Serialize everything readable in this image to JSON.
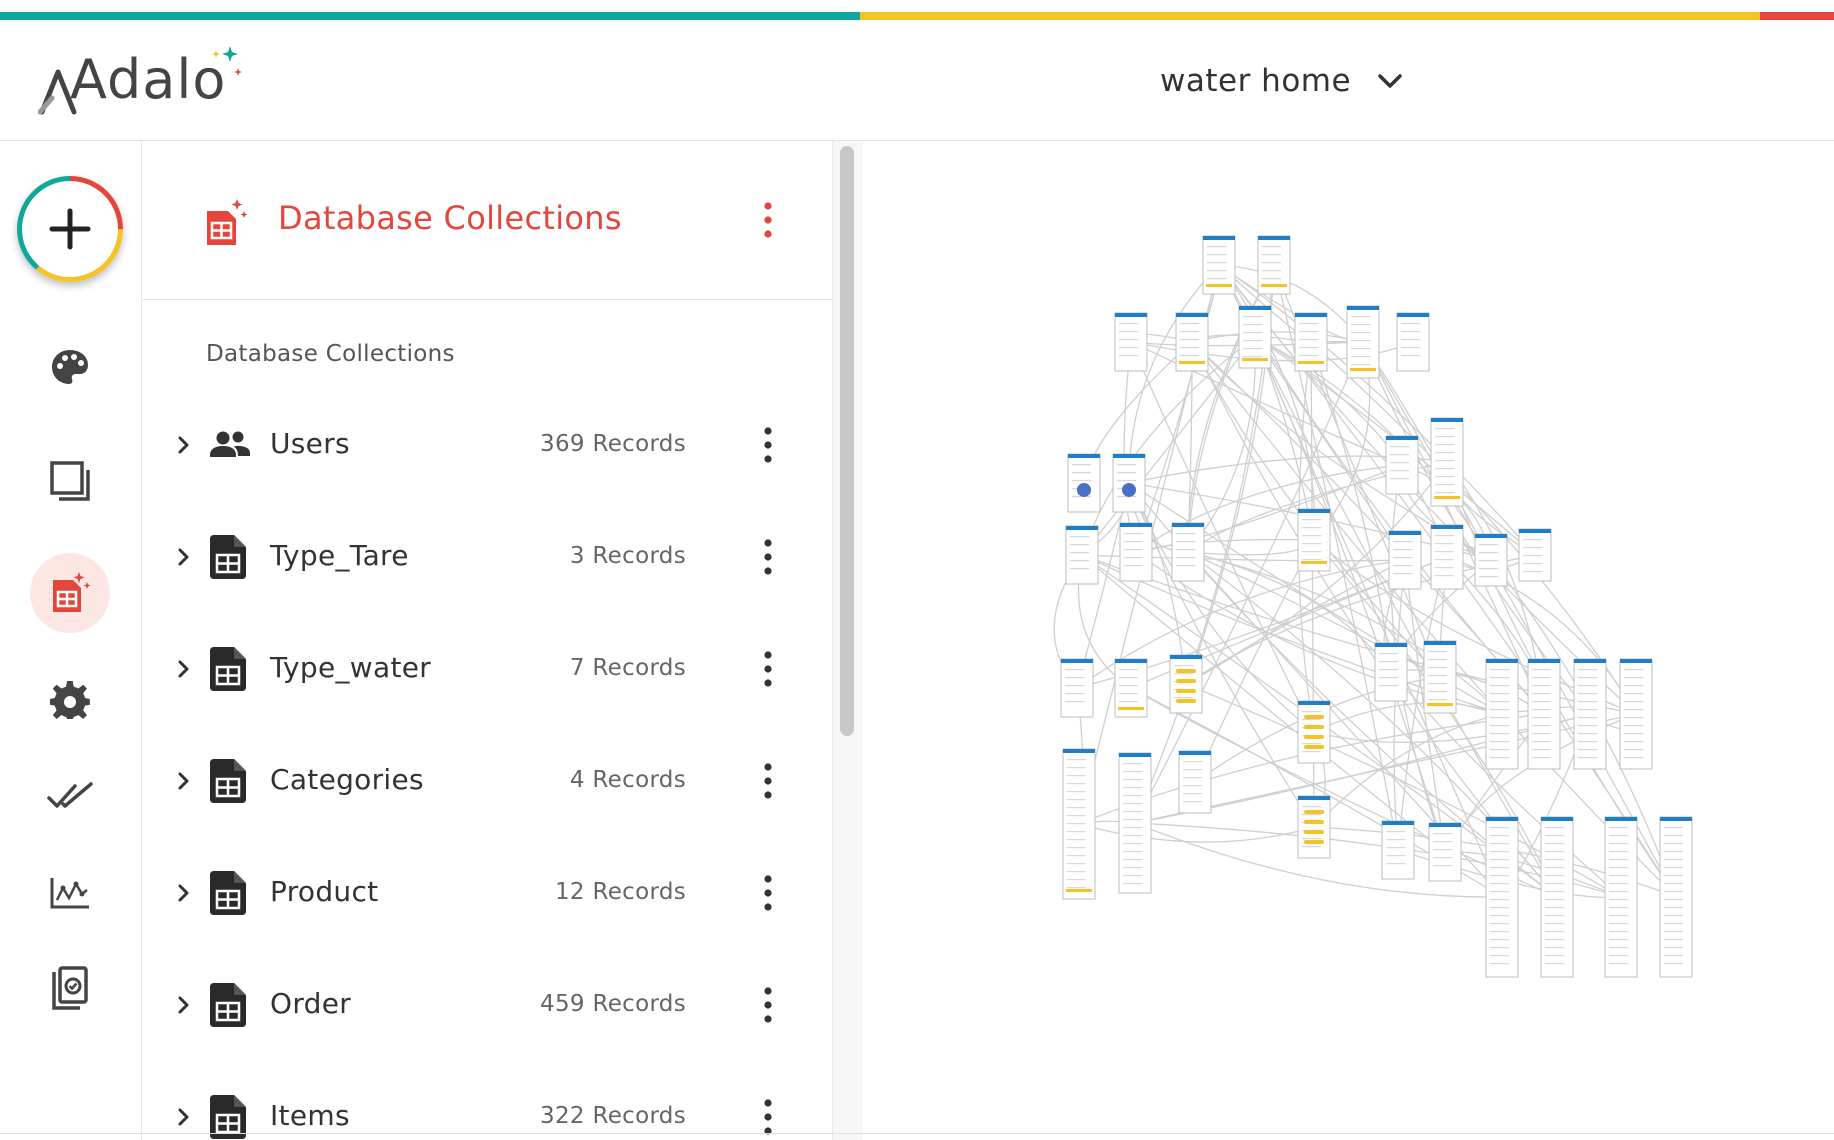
{
  "brand": {
    "logo_text": "Adalo",
    "stripe_colors": [
      "#10a79c",
      "#f5c227",
      "#e4463b"
    ],
    "accent": "#e4463b"
  },
  "header": {
    "app_name": "water home",
    "dropdown_icon": "chevron-down-icon"
  },
  "rail": {
    "add_icon": "plus-icon",
    "items": [
      {
        "icon": "palette-icon",
        "active": false
      },
      {
        "icon": "screens-icon",
        "active": false
      },
      {
        "icon": "database-icon",
        "active": true
      },
      {
        "icon": "gear-icon",
        "active": false
      },
      {
        "icon": "double-check-icon",
        "active": false
      },
      {
        "icon": "analytics-icon",
        "active": false
      },
      {
        "icon": "publish-icon",
        "active": false
      }
    ]
  },
  "panel": {
    "title": "Database Collections",
    "section_label": "Database Collections",
    "collections": [
      {
        "name": "Users",
        "count": "369 Records",
        "icon": "users-icon"
      },
      {
        "name": "Type_Tare",
        "count": "3 Records",
        "icon": "table-doc-icon"
      },
      {
        "name": "Type_water",
        "count": "7 Records",
        "icon": "table-doc-icon"
      },
      {
        "name": "Categories",
        "count": "4 Records",
        "icon": "table-doc-icon"
      },
      {
        "name": "Product",
        "count": "12 Records",
        "icon": "table-doc-icon"
      },
      {
        "name": "Order",
        "count": "459 Records",
        "icon": "table-doc-icon"
      },
      {
        "name": "Items",
        "count": "322 Records",
        "icon": "table-doc-icon"
      }
    ]
  },
  "canvas": {
    "header_color": "#1e7ec8",
    "highlight_color": "#f5c227"
  }
}
